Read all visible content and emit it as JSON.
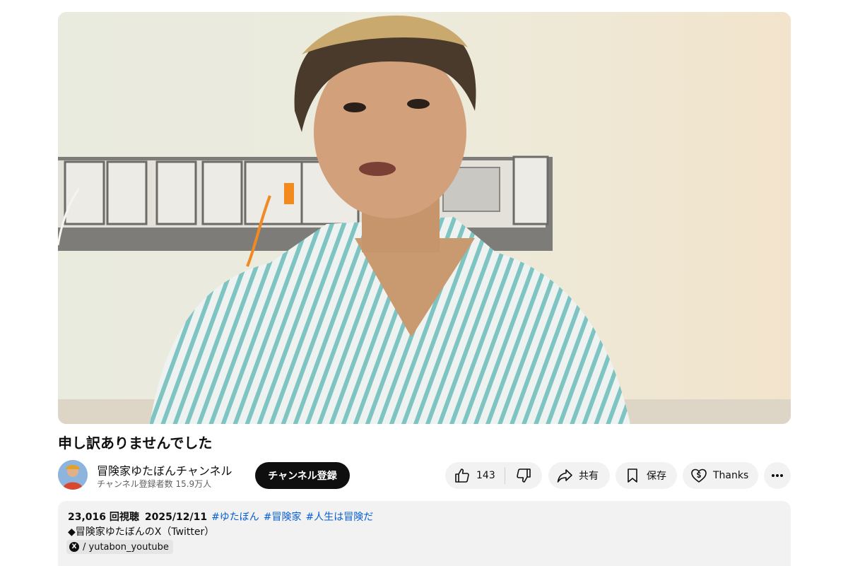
{
  "video": {
    "title": "申し訳ありませんでした"
  },
  "channel": {
    "name": "冒険家ゆたぼんチャンネル",
    "subscribers": "チャンネル登録者数 15.9万人",
    "subscribe_label": "チャンネル登録"
  },
  "actions": {
    "like_count": "143",
    "share_label": "共有",
    "save_label": "保存",
    "thanks_label": "Thanks",
    "more_icon": "more-horizontal-icon"
  },
  "description": {
    "views": "23,016 回視聴",
    "date": "2025/12/11",
    "hashtags": [
      "#ゆたぼん",
      "#冒険家",
      "#人生は冒険だ"
    ],
    "line1": "◆冒険家ゆたぼんのX（Twitter）",
    "x_badge": "X",
    "x_link": "/ yutabon_youtube"
  },
  "colors": {
    "subscribe_bg": "#0f0f0f",
    "pill_bg": "#f2f2f2",
    "hashtag": "#065fd4"
  }
}
